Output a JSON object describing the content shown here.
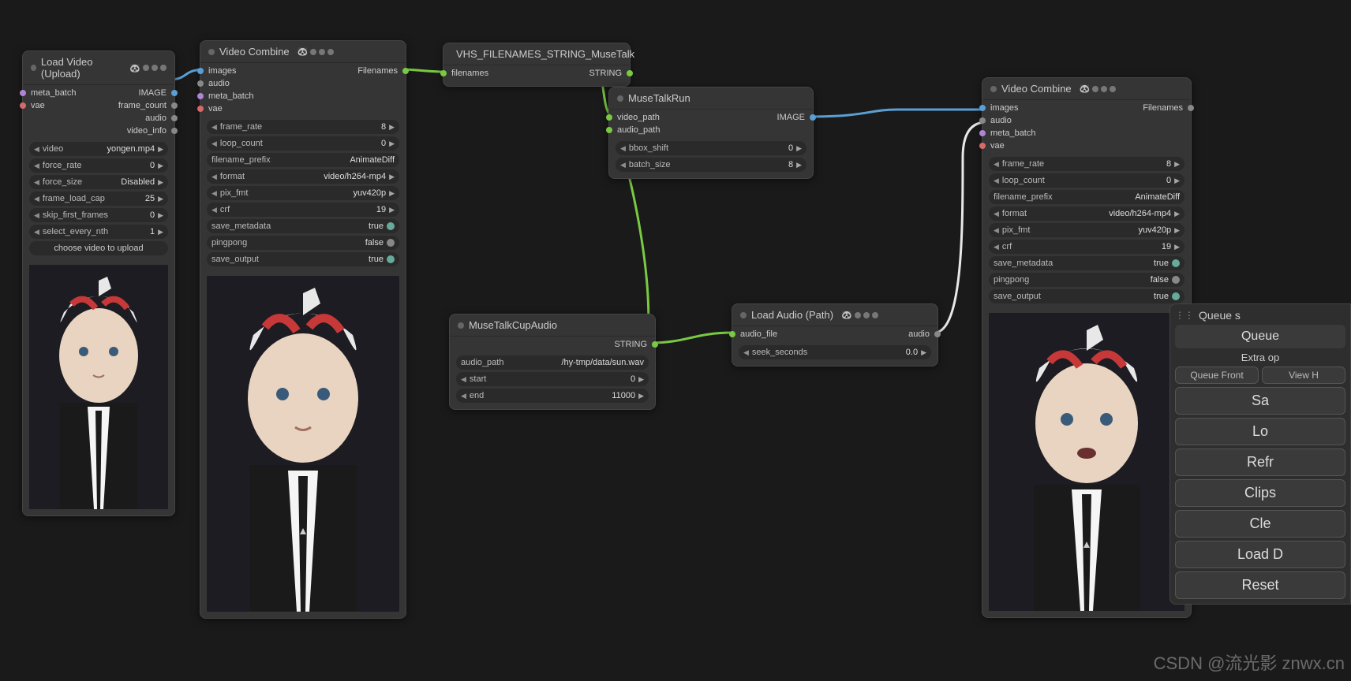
{
  "nodes": {
    "loadVideo": {
      "title": "Load Video (Upload)",
      "ports_in": [
        "meta_batch",
        "vae"
      ],
      "ports_out": [
        "IMAGE",
        "frame_count",
        "audio",
        "video_info"
      ],
      "widgets": {
        "video": {
          "label": "video",
          "value": "yongen.mp4"
        },
        "force_rate": {
          "label": "force_rate",
          "value": "0"
        },
        "force_size": {
          "label": "force_size",
          "value": "Disabled"
        },
        "frame_load_cap": {
          "label": "frame_load_cap",
          "value": "25"
        },
        "skip_first_frames": {
          "label": "skip_first_frames",
          "value": "0"
        },
        "select_every_nth": {
          "label": "select_every_nth",
          "value": "1"
        },
        "choose": "choose video to upload"
      }
    },
    "videoCombine1": {
      "title": "Video Combine",
      "ports_in": [
        "images",
        "audio",
        "meta_batch",
        "vae"
      ],
      "ports_out": [
        "Filenames"
      ],
      "widgets": {
        "frame_rate": {
          "label": "frame_rate",
          "value": "8"
        },
        "loop_count": {
          "label": "loop_count",
          "value": "0"
        },
        "filename_prefix": {
          "label": "filename_prefix",
          "value": "AnimateDiff"
        },
        "format": {
          "label": "format",
          "value": "video/h264-mp4"
        },
        "pix_fmt": {
          "label": "pix_fmt",
          "value": "yuv420p"
        },
        "crf": {
          "label": "crf",
          "value": "19"
        },
        "save_metadata": {
          "label": "save_metadata",
          "value": "true"
        },
        "pingpong": {
          "label": "pingpong",
          "value": "false"
        },
        "save_output": {
          "label": "save_output",
          "value": "true"
        }
      }
    },
    "vhsFilenames": {
      "title": "VHS_FILENAMES_STRING_MuseTalk",
      "ports_in": [
        "filenames"
      ],
      "ports_out": [
        "STRING"
      ]
    },
    "museTalkRun": {
      "title": "MuseTalkRun",
      "ports_in": [
        "video_path",
        "audio_path"
      ],
      "ports_out": [
        "IMAGE"
      ],
      "widgets": {
        "bbox_shift": {
          "label": "bbox_shift",
          "value": "0"
        },
        "batch_size": {
          "label": "batch_size",
          "value": "8"
        }
      }
    },
    "museTalkCupAudio": {
      "title": "MuseTalkCupAudio",
      "ports_out": [
        "STRING"
      ],
      "widgets": {
        "audio_path": {
          "label": "audio_path",
          "value": "/hy-tmp/data/sun.wav"
        },
        "start": {
          "label": "start",
          "value": "0"
        },
        "end": {
          "label": "end",
          "value": "11000"
        }
      }
    },
    "loadAudio": {
      "title": "Load Audio (Path)",
      "ports_in": [
        "audio_file"
      ],
      "ports_out": [
        "audio"
      ],
      "widgets": {
        "seek_seconds": {
          "label": "seek_seconds",
          "value": "0.0"
        }
      }
    },
    "videoCombine2": {
      "title": "Video Combine",
      "ports_in": [
        "images",
        "audio",
        "meta_batch",
        "vae"
      ],
      "ports_out": [
        "Filenames"
      ],
      "widgets": {
        "frame_rate": {
          "label": "frame_rate",
          "value": "8"
        },
        "loop_count": {
          "label": "loop_count",
          "value": "0"
        },
        "filename_prefix": {
          "label": "filename_prefix",
          "value": "AnimateDiff"
        },
        "format": {
          "label": "format",
          "value": "video/h264-mp4"
        },
        "pix_fmt": {
          "label": "pix_fmt",
          "value": "yuv420p"
        },
        "crf": {
          "label": "crf",
          "value": "19"
        },
        "save_metadata": {
          "label": "save_metadata",
          "value": "true"
        },
        "pingpong": {
          "label": "pingpong",
          "value": "false"
        },
        "save_output": {
          "label": "save_output",
          "value": "true"
        }
      }
    }
  },
  "sidePanel": {
    "queue_s": "Queue s",
    "queue": "Queue",
    "extra": "Extra op",
    "queue_front": "Queue Front",
    "view_h": "View H",
    "sa": "Sa",
    "lo": "Lo",
    "refr": "Refr",
    "clips": "Clips",
    "cle": "Cle",
    "load_d": "Load D",
    "reset": "Reset"
  },
  "watermark": "CSDN @流光影   znwx.cn"
}
